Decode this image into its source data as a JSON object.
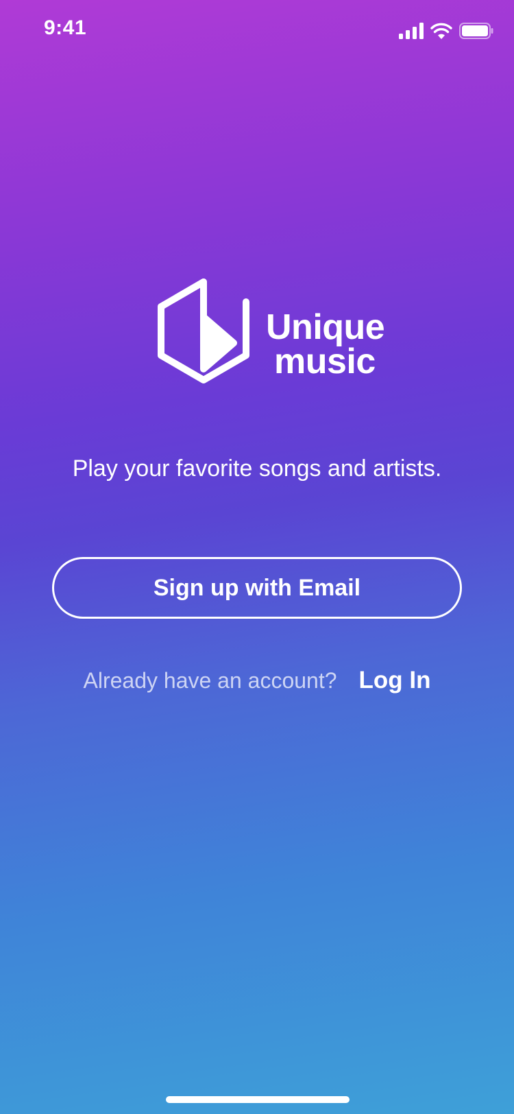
{
  "status_bar": {
    "time": "9:41",
    "icons": [
      "signal-icon",
      "wifi-icon",
      "battery-icon"
    ]
  },
  "logo": {
    "icon": "hexagon-play-icon",
    "word_1": "Unique",
    "word_2": "music"
  },
  "tagline": "Play your favorite songs and artists.",
  "signup_button": {
    "label": "Sign up with Email"
  },
  "login": {
    "prompt": "Already have an account?",
    "link_label": "Log In"
  },
  "colors": {
    "gradient_top": "#b03ad6",
    "gradient_mid": "#5a45d3",
    "gradient_bottom": "#3ea0d8",
    "text": "#ffffff"
  }
}
